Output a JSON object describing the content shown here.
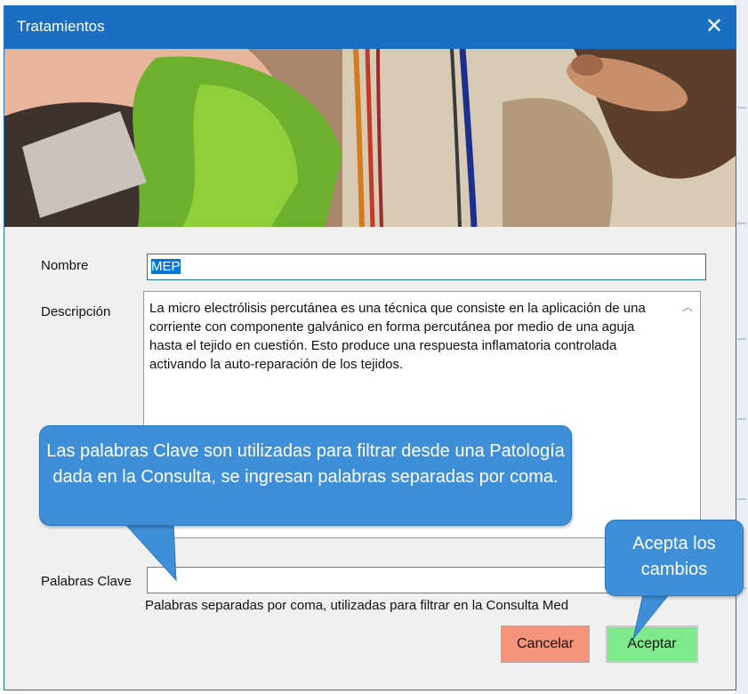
{
  "window": {
    "title": "Tratamientos",
    "close_icon": "close-icon"
  },
  "form": {
    "nombre_label": "Nombre",
    "nombre_value": "MEP",
    "descripcion_label": "Descripción",
    "descripcion_value": "La micro electrólisis percutánea es una técnica que consiste en la aplicación de una corriente con componente galvánico en forma percutánea por medio de una aguja hasta el tejido en cuestión. Esto produce una respuesta inflamatoria controlada activando la auto-reparación de los tejidos.",
    "palabras_label": "Palabras Clave",
    "palabras_value": "",
    "palabras_hint": "Palabras separadas por coma, utilizadas para filtrar en la Consulta Med"
  },
  "buttons": {
    "cancel_label": "Cancelar",
    "accept_label": "Aceptar"
  },
  "callouts": {
    "keywords": "Las palabras Clave son utilizadas para filtrar desde una Patología dada en la Consulta, se ingresan palabras separadas por coma.",
    "accept": "Acepta los cambios"
  },
  "colors": {
    "titlebar": "#1b6fc2",
    "callout": "#3f8ed8",
    "cancel": "#f4957b",
    "accept": "#7fea8d"
  }
}
